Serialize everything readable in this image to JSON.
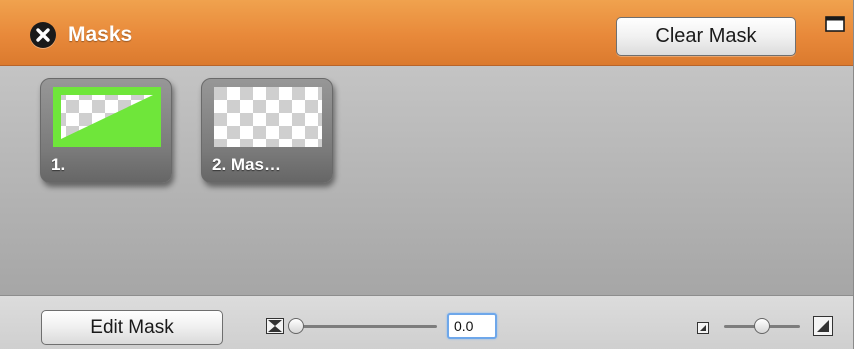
{
  "header": {
    "title": "Masks",
    "clear_button_label": "Clear Mask",
    "accent_color": "#e8893a"
  },
  "icons": {
    "close": "close-icon",
    "window": "window-icon",
    "feather": "feather-icon",
    "thumb_size_small": "thumb-size-small-icon",
    "thumb_size_large": "thumb-size-large-icon"
  },
  "masks": [
    {
      "label": "1.",
      "fill_color": "#6fe63a"
    },
    {
      "label": "2. Mas…"
    }
  ],
  "footer": {
    "edit_button_label": "Edit Mask",
    "feather_value": "0.0",
    "feather_slider_level": 0.0,
    "thumbnail_size_slider_level": 0.5
  }
}
